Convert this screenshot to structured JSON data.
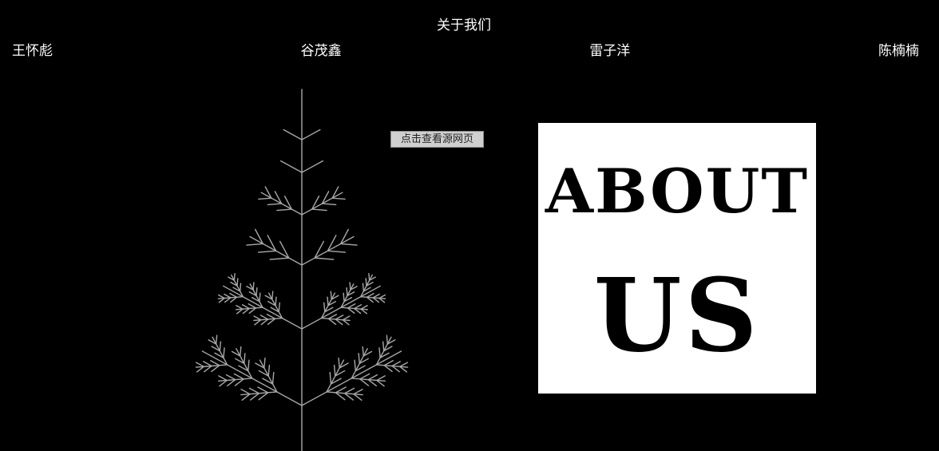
{
  "header": {
    "title": "关于我们"
  },
  "team": {
    "members": [
      {
        "name": "王怀彪"
      },
      {
        "name": "谷茂鑫"
      },
      {
        "name": "雷子洋"
      },
      {
        "name": "陈楠楠"
      }
    ]
  },
  "main": {
    "source_button_label": "点击查看源网页",
    "about_image": {
      "line_1": "ABOUT",
      "line_2": "US"
    }
  },
  "colors": {
    "background": "#000000",
    "text": "#ffffff",
    "tree": "#a8a8a8",
    "panel": "#ffffff"
  }
}
